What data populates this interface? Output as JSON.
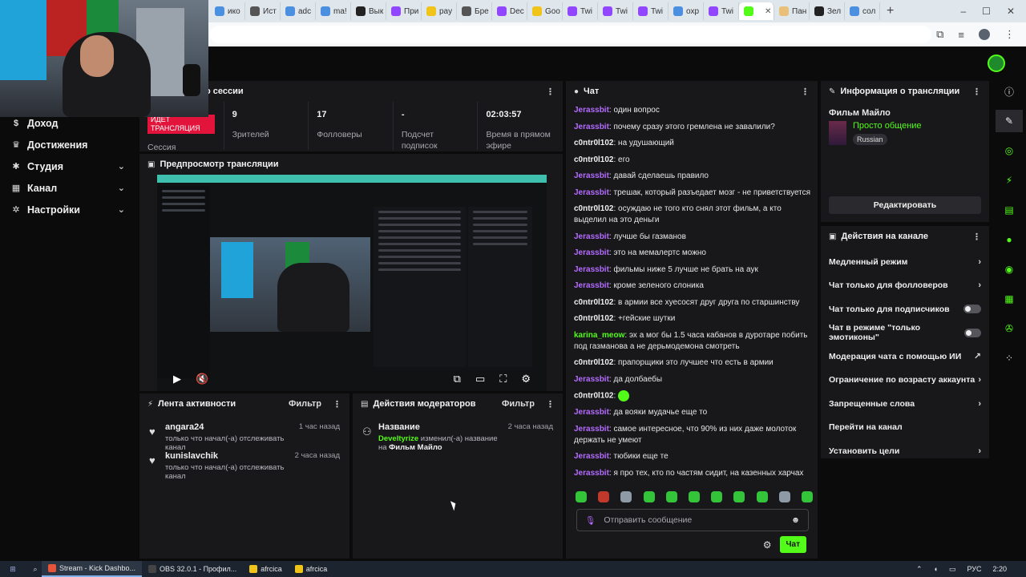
{
  "browser": {
    "tabs": [
      {
        "label": "ико",
        "color": "#4a8fe0"
      },
      {
        "label": "Ист",
        "color": "#555"
      },
      {
        "label": "adc",
        "color": "#4a8fe0"
      },
      {
        "label": "ma!",
        "color": "#4a8fe0"
      },
      {
        "label": "Вык",
        "color": "#222"
      },
      {
        "label": "При",
        "color": "#9146ff"
      },
      {
        "label": "pay",
        "color": "#f0c419"
      },
      {
        "label": "Бре",
        "color": "#555"
      },
      {
        "label": "Dec",
        "color": "#9146ff"
      },
      {
        "label": "Goo",
        "color": "#f0c419"
      },
      {
        "label": "Twi",
        "color": "#9146ff"
      },
      {
        "label": "Twi",
        "color": "#9146ff"
      },
      {
        "label": "Twi",
        "color": "#9146ff"
      },
      {
        "label": "oxp",
        "color": "#4a8fe0"
      },
      {
        "label": "Twi",
        "color": "#9146ff"
      },
      {
        "label": "",
        "color": "#53fc18",
        "active": true
      },
      {
        "label": "Пан",
        "color": "#e8c07a"
      },
      {
        "label": "Зел",
        "color": "#222"
      },
      {
        "label": "сол",
        "color": "#4a8fe0"
      }
    ],
    "new_tab": "+",
    "window_controls": [
      "–",
      "☐",
      "✕"
    ]
  },
  "sidebar": {
    "items": [
      {
        "label": "Доход",
        "icon": "coin-icon",
        "glyph": "$",
        "chevron": false
      },
      {
        "label": "Достижения",
        "icon": "trophy-icon",
        "glyph": "♛",
        "chevron": false
      },
      {
        "label": "Студия",
        "icon": "gear-icon",
        "glyph": "✱",
        "chevron": true
      },
      {
        "label": "Канал",
        "icon": "grid-icon",
        "glyph": "▦",
        "chevron": true
      },
      {
        "label": "Настройки",
        "icon": "cog-icon",
        "glyph": "✲",
        "chevron": true
      }
    ]
  },
  "session": {
    "title": "о сессии",
    "live_badge": "ИДЕТ ТРАНСЛЯЦИЯ",
    "session_label": "Сессия",
    "stats": [
      {
        "value": "9",
        "label": "Зрителей"
      },
      {
        "value": "17",
        "label": "Фолловеры"
      },
      {
        "value": "-",
        "label": "Подсчет подписок"
      },
      {
        "value": "02:03:57",
        "label": "Время в прямом эфире"
      }
    ]
  },
  "preview": {
    "title": "Предпросмотр трансляции"
  },
  "activity": {
    "title": "Лента активности",
    "filter": "Фильтр",
    "items": [
      {
        "name": "angara24",
        "desc": "только что начал(-а) отслеживать канал",
        "time": "1 час назад"
      },
      {
        "name": "kunislavchik",
        "desc": "только что начал(-а) отслеживать канал",
        "time": "2 часа назад"
      }
    ]
  },
  "moderators": {
    "title": "Действия модераторов",
    "filter": "Фильтр",
    "item": {
      "name": "Название",
      "time": "2 часа назад",
      "user": "Develtyrize",
      "action": " изменил(-а) название на ",
      "target": "Фильм Майло"
    }
  },
  "chat": {
    "title": "Чат",
    "messages": [
      {
        "user": "Jerassbit",
        "type": "j",
        "text": "один вопрос"
      },
      {
        "user": "Jerassbit",
        "type": "j",
        "text": "почему сразу этого гремлена не завалили?"
      },
      {
        "user": "c0ntr0l102",
        "type": "c",
        "text": "на удушающий"
      },
      {
        "user": "c0ntr0l102",
        "type": "c",
        "text": "его"
      },
      {
        "user": "Jerassbit",
        "type": "j",
        "text": "давай сделаешь правило"
      },
      {
        "user": "Jerassbit",
        "type": "j",
        "text": "трешак, который разъедает мозг - не приветствуется"
      },
      {
        "user": "c0ntr0l102",
        "type": "c",
        "text": "осуждаю не того кто снял этот фильм, а кто выделил на это деньги"
      },
      {
        "user": "Jerassbit",
        "type": "j",
        "text": "лучше бы газманов"
      },
      {
        "user": "Jerassbit",
        "type": "j",
        "text": "это на мемалертс можно"
      },
      {
        "user": "Jerassbit",
        "type": "j",
        "text": "фильмы ниже 5 лучше не брать на аук"
      },
      {
        "user": "Jerassbit",
        "type": "j",
        "text": "кроме зеленого слоника"
      },
      {
        "user": "c0ntr0l102",
        "type": "c",
        "text": "в армии все хуесосят друг друга по старшинству"
      },
      {
        "user": "c0ntr0l102",
        "type": "c",
        "text": "+гейские шутки"
      },
      {
        "user": "karina_meow",
        "type": "k",
        "text": "эх а мог бы 1.5 часа кабанов в дуротаре побить под газманова а не дерьмодемона смотреть"
      },
      {
        "user": "c0ntr0l102",
        "type": "c",
        "text": "прапорщики это лучшее что есть в армии"
      },
      {
        "user": "Jerassbit",
        "type": "j",
        "text": "да долбаебы"
      },
      {
        "user": "c0ntr0l102",
        "type": "c",
        "text": "",
        "emote": true
      },
      {
        "user": "Jerassbit",
        "type": "j",
        "text": "да вояки мудачье еще то"
      },
      {
        "user": "Jerassbit",
        "type": "j",
        "text": "самое интересное, что 90% из них даже молоток держать не умеют"
      },
      {
        "user": "Jerassbit",
        "type": "j",
        "text": "тюбики еще те"
      },
      {
        "user": "Jerassbit",
        "type": "j",
        "text": "я про тех, кто по частям сидит, на казенных харчах"
      }
    ],
    "placeholder": "Отправить сообщение",
    "send_label": "Чат"
  },
  "info": {
    "title": "Информация о трансляции",
    "stream_title": "Фильм Майло",
    "category": "Просто общение",
    "tag": "Russian",
    "edit_label": "Редактировать"
  },
  "channel_actions": {
    "title": "Действия на канале",
    "items": [
      {
        "label": "Медленный режим",
        "control": "chevron"
      },
      {
        "label": "Чат только для фолловеров",
        "control": "chevron"
      },
      {
        "label": "Чат только для подписчиков",
        "control": "toggle"
      },
      {
        "label": "Чат в режиме \"только эмотиконы\"",
        "control": "toggle"
      },
      {
        "label": "Модерация чата с помощью ИИ",
        "control": "external"
      },
      {
        "label": "Ограничение по возрасту аккаунта",
        "control": "chevron"
      },
      {
        "label": "Запрещенные слова",
        "control": "chevron"
      },
      {
        "label": "Перейти на канал",
        "control": "none"
      },
      {
        "label": "Установить цели",
        "control": "chevron"
      }
    ]
  },
  "taskbar": {
    "apps": [
      {
        "label": "Stream - Kick Dashbo...",
        "color": "#e8543a",
        "active": true
      },
      {
        "label": "OBS 32.0.1 - Профил...",
        "color": "#444",
        "active": false
      },
      {
        "label": "afrcica",
        "color": "#f0c419",
        "active": false
      },
      {
        "label": "afrcica",
        "color": "#f0c419",
        "active": false
      }
    ],
    "lang": "РУС",
    "time": "2:20"
  }
}
